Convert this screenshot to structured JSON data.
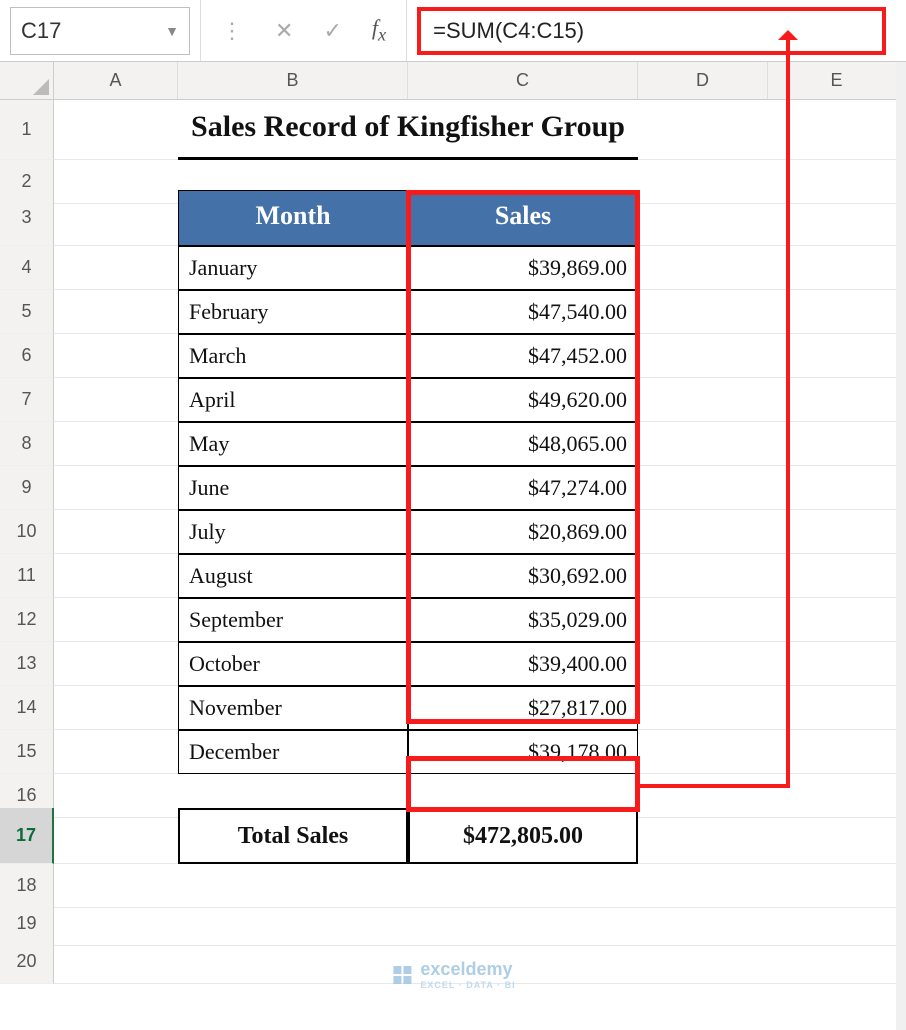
{
  "namebox": {
    "value": "C17"
  },
  "formula_bar": {
    "value": "=SUM(C4:C15)"
  },
  "columns": [
    "A",
    "B",
    "C",
    "D",
    "E"
  ],
  "rows": [
    "1",
    "2",
    "3",
    "4",
    "5",
    "6",
    "7",
    "8",
    "9",
    "10",
    "11",
    "12",
    "13",
    "14",
    "15",
    "16",
    "17",
    "18",
    "19",
    "20"
  ],
  "title": "Sales Record of Kingfisher Group",
  "headers": {
    "month": "Month",
    "sales": "Sales"
  },
  "data": [
    {
      "month": "January",
      "sales": "$39,869.00"
    },
    {
      "month": "February",
      "sales": "$47,540.00"
    },
    {
      "month": "March",
      "sales": "$47,452.00"
    },
    {
      "month": "April",
      "sales": "$49,620.00"
    },
    {
      "month": "May",
      "sales": "$48,065.00"
    },
    {
      "month": "June",
      "sales": "$47,274.00"
    },
    {
      "month": "July",
      "sales": "$20,869.00"
    },
    {
      "month": "August",
      "sales": "$30,692.00"
    },
    {
      "month": "September",
      "sales": "$35,029.00"
    },
    {
      "month": "October",
      "sales": "$39,400.00"
    },
    {
      "month": "November",
      "sales": "$27,817.00"
    },
    {
      "month": "December",
      "sales": "$39,178.00"
    }
  ],
  "total": {
    "label": "Total Sales",
    "value": "$472,805.00"
  },
  "watermark": {
    "brand": "exceldemy",
    "tag": "EXCEL · DATA · BI"
  }
}
